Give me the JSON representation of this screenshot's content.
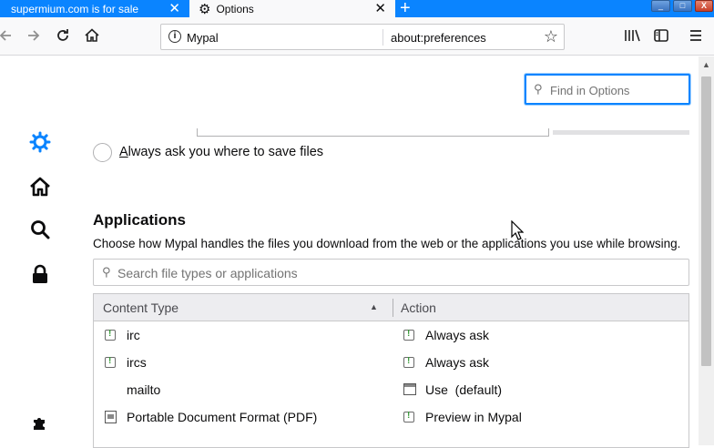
{
  "tabs": [
    {
      "label": "supermium.com is for sale",
      "active": false
    },
    {
      "label": "Options",
      "active": true
    }
  ],
  "new_tab_symbol": "+",
  "window_controls": {
    "minimize": "_",
    "maximize": "□",
    "close": "X"
  },
  "urlbar": {
    "identity": "Mypal",
    "url": "about:preferences"
  },
  "find": {
    "placeholder": "Find in Options"
  },
  "downloads": {
    "always_ask_prefix": "A",
    "always_ask_rest": "lways ask you where to save files"
  },
  "applications": {
    "heading": "Applications",
    "description": "Choose how Mypal handles the files you download from the web or the applications you use while browsing.",
    "search_placeholder": "Search file types or applications",
    "columns": {
      "content_type": "Content Type",
      "action": "Action"
    },
    "rows": [
      {
        "type": "irc",
        "action": "Always ask",
        "type_icon": "chat-icon",
        "action_icon": "chat-icon"
      },
      {
        "type": "ircs",
        "action": "Always ask",
        "type_icon": "chat-icon",
        "action_icon": "chat-icon"
      },
      {
        "type": "mailto",
        "action": "Use  (default)",
        "type_icon": "none",
        "action_icon": "app-icon"
      },
      {
        "type": "Portable Document Format (PDF)",
        "action": "Preview in Mypal",
        "type_icon": "pdf-icon",
        "action_icon": "chat-icon"
      }
    ]
  },
  "colors": {
    "accent": "#0a84ff",
    "toolbar": "#f9f9fa",
    "sidebar_active": "#0a84ff"
  }
}
